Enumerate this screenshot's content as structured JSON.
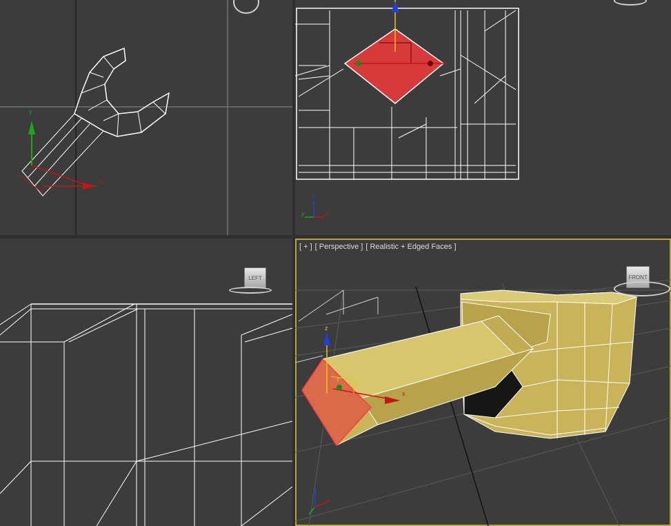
{
  "viewports": {
    "top_left": {
      "axes": {
        "x": "x",
        "y": "y"
      }
    },
    "top_right": {
      "axes": {
        "x": "x",
        "y": "y",
        "z": "z"
      }
    },
    "bottom_left": {
      "viewcube": "LEFT"
    },
    "bottom_right": {
      "label_parts": [
        "[ + ]",
        "[ Perspective ]",
        "[ Realistic + Edged Faces ]"
      ],
      "viewcube": "FRONT",
      "axes": {
        "x": "x",
        "y": "y",
        "z": "z"
      }
    }
  },
  "colors": {
    "viewport_bg": "#3c3c3c",
    "active_border": "#b8a43a",
    "wire": "#ffffff",
    "selected_face": "#d63a3a",
    "mesh_yellow": "#c9b45a"
  }
}
